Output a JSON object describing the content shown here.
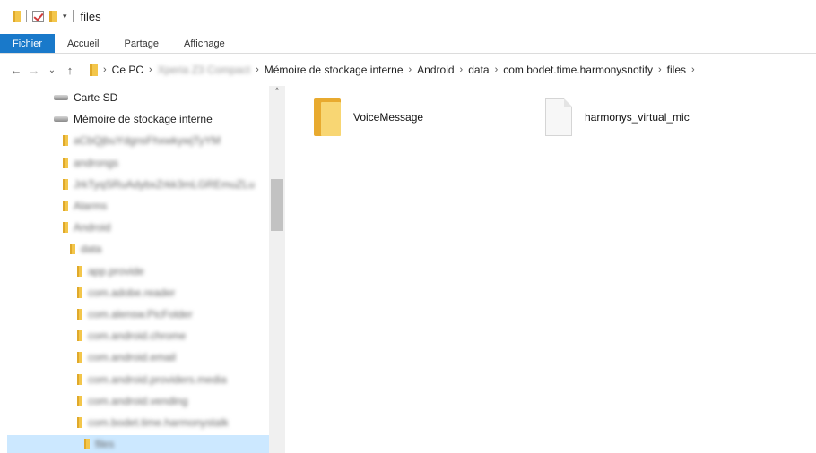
{
  "window": {
    "title": "files"
  },
  "ribbon": {
    "tabs": [
      "Fichier",
      "Accueil",
      "Partage",
      "Affichage"
    ]
  },
  "address": {
    "crumbs": [
      {
        "label": "Ce PC",
        "blurred": false
      },
      {
        "label": "Xperia Z3 Compact",
        "blurred": true
      },
      {
        "label": "Mémoire de stockage interne",
        "blurred": false
      },
      {
        "label": "Android",
        "blurred": false
      },
      {
        "label": "data",
        "blurred": false
      },
      {
        "label": "com.bodet.time.harmonysnotify",
        "blurred": false
      },
      {
        "label": "files",
        "blurred": false
      }
    ]
  },
  "nav": {
    "items": [
      {
        "label": "Carte SD",
        "icon": "drive-icon",
        "indent": 0,
        "blurred": false
      },
      {
        "label": "Mémoire de stockage interne",
        "icon": "drive-icon",
        "indent": 0,
        "blurred": false
      },
      {
        "label": "aCbQjbuYdgnsFhxwkywjTyYM",
        "icon": "folder-icon",
        "indent": 1,
        "blurred": true
      },
      {
        "label": "androngs",
        "icon": "folder-icon",
        "indent": 1,
        "blurred": true
      },
      {
        "label": "JrkTyqSRuAdybxZrkk3mLGREmuZLu",
        "icon": "folder-icon",
        "indent": 1,
        "blurred": true
      },
      {
        "label": "Alarms",
        "icon": "folder-icon",
        "indent": 1,
        "blurred": true
      },
      {
        "label": "Android",
        "icon": "folder-icon",
        "indent": 1,
        "blurred": true
      },
      {
        "label": "data",
        "icon": "folder-icon",
        "indent": 2,
        "blurred": true
      },
      {
        "label": "app.provide",
        "icon": "folder-icon",
        "indent": 3,
        "blurred": true
      },
      {
        "label": "com.adobe.reader",
        "icon": "folder-icon",
        "indent": 3,
        "blurred": true
      },
      {
        "label": "com.alensw.PicFolder",
        "icon": "folder-icon",
        "indent": 3,
        "blurred": true
      },
      {
        "label": "com.android.chrome",
        "icon": "folder-icon",
        "indent": 3,
        "blurred": true
      },
      {
        "label": "com.android.email",
        "icon": "folder-icon",
        "indent": 3,
        "blurred": true
      },
      {
        "label": "com.android.providers.media",
        "icon": "folder-icon",
        "indent": 3,
        "blurred": true
      },
      {
        "label": "com.android.vending",
        "icon": "folder-icon",
        "indent": 3,
        "blurred": true
      },
      {
        "label": "com.bodet.time.harmonystalk",
        "icon": "folder-icon",
        "indent": 3,
        "blurred": true
      },
      {
        "label": "files",
        "icon": "folder-icon",
        "indent": 4,
        "blurred": true,
        "selected": true
      }
    ]
  },
  "content": {
    "items": [
      {
        "name": "VoiceMessage",
        "type": "folder"
      },
      {
        "name": "harmonys_virtual_mic",
        "type": "file"
      }
    ]
  }
}
